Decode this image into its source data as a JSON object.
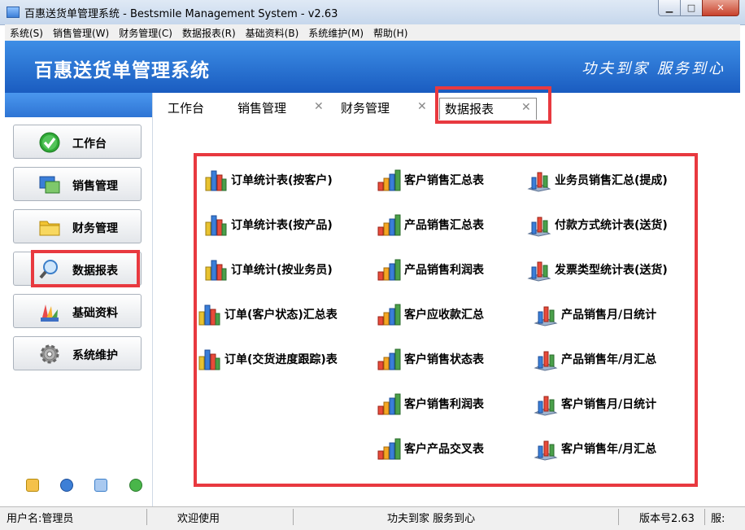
{
  "window": {
    "title": "百惠送货单管理系统 - Bestsmile Management System - v2.63",
    "min_icon": "minimize-icon",
    "max_icon": "maximize-icon",
    "close_icon": "close-icon"
  },
  "menu": [
    "系统(S)",
    "销售管理(W)",
    "财务管理(C)",
    "数据报表(R)",
    "基础资料(B)",
    "系统维护(M)",
    "帮助(H)"
  ],
  "banner": {
    "brand": "百惠送货单管理系统",
    "slogan": "功夫到家 服务到心"
  },
  "nav": [
    {
      "label": "工作台",
      "icon": "checkmark-icon"
    },
    {
      "label": "销售管理",
      "icon": "windows-icon"
    },
    {
      "label": "财务管理",
      "icon": "folder-icon"
    },
    {
      "label": "数据报表",
      "icon": "magnifier-icon"
    },
    {
      "label": "基础资料",
      "icon": "color-palette-icon"
    },
    {
      "label": "系统维护",
      "icon": "gear-icon"
    }
  ],
  "footer_icons": [
    "key-icon",
    "clock-icon",
    "search-icon",
    "back-arrow-icon"
  ],
  "tabs": [
    {
      "label": "工作台",
      "closable": false
    },
    {
      "label": "销售管理",
      "closable": true
    },
    {
      "label": "财务管理",
      "closable": true
    },
    {
      "label": "数据报表",
      "closable": true,
      "active": true
    }
  ],
  "reports": {
    "col1": [
      "订单统计表(按客户)",
      "订单统计表(按产品)",
      "订单统计(按业务员)",
      "订单(客户状态)汇总表",
      "订单(交货进度跟踪)表"
    ],
    "col2": [
      "客户销售汇总表",
      "产品销售汇总表",
      "产品销售利润表",
      "客户应收款汇总",
      "客户销售状态表",
      "客户销售利润表",
      "客户产品交叉表"
    ],
    "col3": [
      "业务员销售汇总(提成)",
      "付款方式统计表(送货)",
      "发票类型统计表(送货)",
      "产品销售月/日统计",
      "产品销售年/月汇总",
      "客户销售月/日统计",
      "客户销售年/月汇总"
    ]
  },
  "status": {
    "user": "用户名:管理员",
    "welcome": "欢迎使用",
    "slogan": "功夫到家 服务到心",
    "version": "版本号2.63",
    "extra": "服:"
  },
  "colors": {
    "accent": "#1a5cc0",
    "highlight": "#e8393f"
  }
}
